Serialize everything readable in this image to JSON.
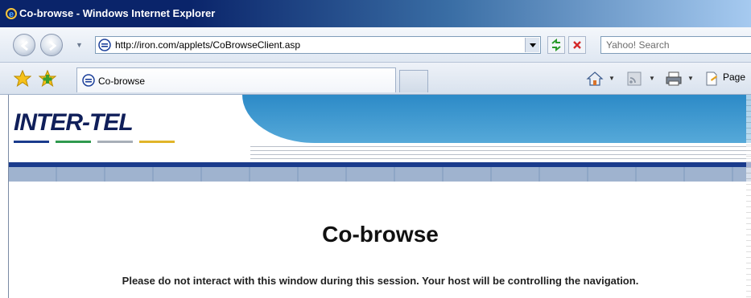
{
  "window": {
    "title": "Co-browse - Windows Internet Explorer"
  },
  "navbar": {
    "url": "http://iron.com/applets/CoBrowseClient.asp",
    "search_placeholder": "Yahoo! Search"
  },
  "tabs": [
    {
      "label": "Co-browse"
    }
  ],
  "command_bar": {
    "page_label": "Page"
  },
  "page": {
    "logo_text": "INTER-TEL",
    "heading": "Co-browse",
    "notice": "Please do not interact with this window during this session. Your host will be controlling the navigation."
  },
  "colors": {
    "title_bar": "#0a246a",
    "banner_blue": "#2c8ac7",
    "logo_navy": "#101f5a",
    "stripe_navy": "#1a3b8c"
  }
}
